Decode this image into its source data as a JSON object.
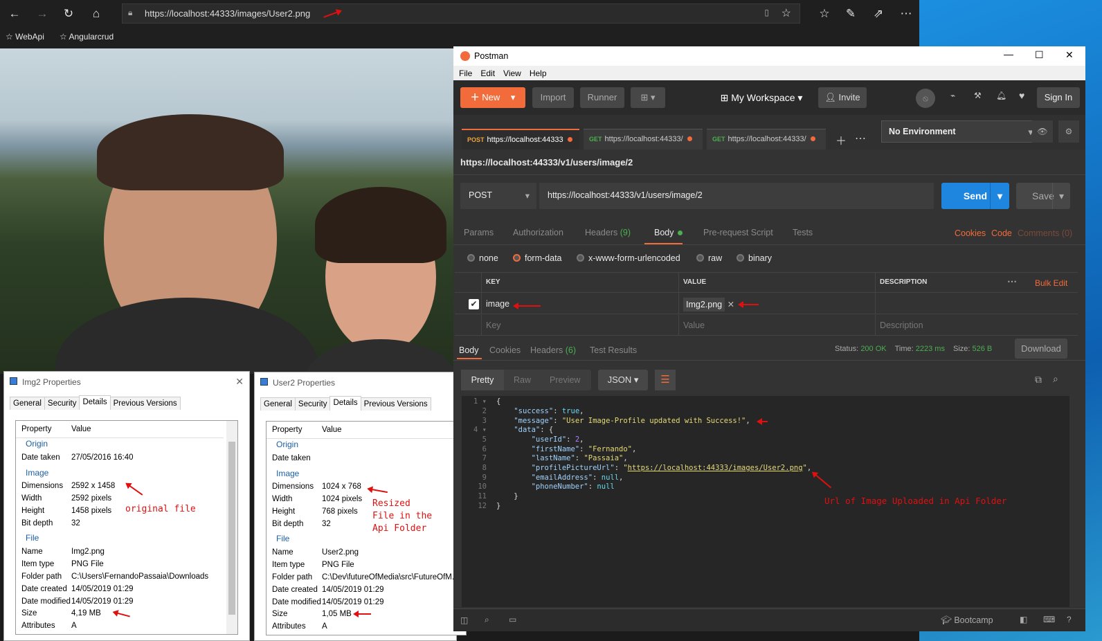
{
  "browser": {
    "url": "https://localhost:44333/images/User2.png",
    "favorites": [
      "WebApi",
      "Angularcrud"
    ]
  },
  "img2": {
    "title": "Img2 Properties",
    "tabs": [
      "General",
      "Security",
      "Details",
      "Previous Versions"
    ],
    "col_property": "Property",
    "col_value": "Value",
    "origin": "Origin",
    "date_taken_l": "Date taken",
    "date_taken": "27/05/2016 16:40",
    "image": "Image",
    "dim_l": "Dimensions",
    "dim": "2592 x 1458",
    "width_l": "Width",
    "width": "2592 pixels",
    "height_l": "Height",
    "height": "1458 pixels",
    "bit_l": "Bit depth",
    "bit": "32",
    "file": "File",
    "name_l": "Name",
    "name": "Img2.png",
    "type_l": "Item type",
    "type": "PNG File",
    "folder_l": "Folder path",
    "folder": "C:\\Users\\FernandoPassaia\\Downloads",
    "created_l": "Date created",
    "created": "14/05/2019 01:29",
    "modified_l": "Date modified",
    "modified": "14/05/2019 01:29",
    "size_l": "Size",
    "size": "4,19 MB",
    "attr_l": "Attributes",
    "attr": "A"
  },
  "user2": {
    "title": "User2 Properties",
    "tabs": [
      "General",
      "Security",
      "Details",
      "Previous Versions"
    ],
    "col_property": "Property",
    "col_value": "Value",
    "origin": "Origin",
    "date_taken_l": "Date taken",
    "date_taken": "",
    "image": "Image",
    "dim_l": "Dimensions",
    "dim": "1024 x 768",
    "width_l": "Width",
    "width": "1024 pixels",
    "height_l": "Height",
    "height": "768 pixels",
    "bit_l": "Bit depth",
    "bit": "32",
    "file": "File",
    "name_l": "Name",
    "name": "User2.png",
    "type_l": "Item type",
    "type": "PNG File",
    "folder_l": "Folder path",
    "folder": "C:\\Dev\\futureOfMedia\\src\\FutureOfM...",
    "created_l": "Date created",
    "created": "14/05/2019 01:29",
    "modified_l": "Date modified",
    "modified": "14/05/2019 01:29",
    "size_l": "Size",
    "size": "1,05 MB",
    "attr_l": "Attributes",
    "attr": "A"
  },
  "notes": {
    "original": "original file",
    "resized1": "Resized",
    "resized2": "File in the",
    "resized3": "Api Folder",
    "url_note": "Url of Image Uploaded in Api Folder"
  },
  "postman": {
    "title": "Postman",
    "menu": [
      "File",
      "Edit",
      "View",
      "Help"
    ],
    "new": "New",
    "import": "Import",
    "runner": "Runner",
    "workspace": "My Workspace",
    "invite": "Invite",
    "signin": "Sign In",
    "tabs": [
      {
        "method": "POST",
        "url": "https://localhost:44333"
      },
      {
        "method": "GET",
        "url": "https://localhost:44333/"
      },
      {
        "method": "GET",
        "url": "https://localhost:44333/"
      }
    ],
    "environment": "No Environment",
    "req_name": "https://localhost:44333/v1/users/image/2",
    "method": "POST",
    "req_url": "https://localhost:44333/v1/users/image/2",
    "send": "Send",
    "save": "Save",
    "rtabs": {
      "params": "Params",
      "auth": "Authorization",
      "headers": "Headers",
      "headers_count": "(9)",
      "body": "Body",
      "prereq": "Pre-request Script",
      "tests": "Tests",
      "cookies": "Cookies",
      "code": "Code",
      "comments": "Comments (0)"
    },
    "body_types": [
      "none",
      "form-data",
      "x-www-form-urlencoded",
      "raw",
      "binary"
    ],
    "kv": {
      "key": "KEY",
      "value": "VALUE",
      "desc": "DESCRIPTION",
      "bulk": "Bulk Edit",
      "row_key": "image",
      "row_value": "Img2.png",
      "ph_key": "Key",
      "ph_value": "Value",
      "ph_desc": "Description"
    },
    "resp": {
      "body": "Body",
      "cookies": "Cookies",
      "headers": "Headers",
      "headers_count": "(6)",
      "tests": "Test Results",
      "status_l": "Status:",
      "status": "200 OK",
      "time_l": "Time:",
      "time": "2223 ms",
      "size_l": "Size:",
      "size": "526 B",
      "download": "Download",
      "pretty": "Pretty",
      "raw": "Raw",
      "preview": "Preview",
      "format": "JSON"
    },
    "bootcamp": "Bootcamp"
  }
}
